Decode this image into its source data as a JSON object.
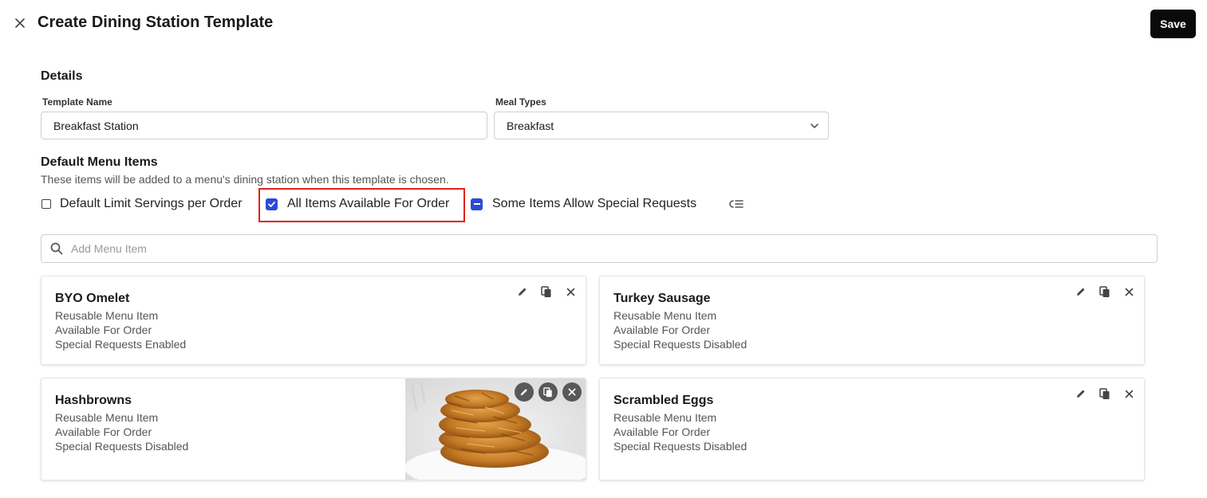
{
  "header": {
    "title": "Create Dining Station Template",
    "save_label": "Save"
  },
  "details": {
    "section_title": "Details",
    "template_name_label": "Template Name",
    "template_name_value": "Breakfast Station",
    "meal_types_label": "Meal Types",
    "meal_types_value": "Breakfast"
  },
  "menu": {
    "section_title": "Default Menu Items",
    "description": "These items will be added to a menu's dining station when this template is chosen.",
    "options": {
      "limit_servings": {
        "label": "Default Limit Servings per Order",
        "state": "unchecked"
      },
      "all_available": {
        "label": "All Items Available For Order",
        "state": "checked"
      },
      "special_requests": {
        "label": "Some Items Allow Special Requests",
        "state": "indeterminate"
      }
    },
    "search_placeholder": "Add Menu Item",
    "items": [
      {
        "name": "BYO Omelet",
        "line1": "Reusable Menu Item",
        "line2": "Available For Order",
        "line3": "Special Requests Enabled"
      },
      {
        "name": "Turkey Sausage",
        "line1": "Reusable Menu Item",
        "line2": "Available For Order",
        "line3": "Special Requests Disabled"
      },
      {
        "name": "Hashbrowns",
        "line1": "Reusable Menu Item",
        "line2": "Available For Order",
        "line3": "Special Requests Disabled",
        "image": "hashbrowns-photo"
      },
      {
        "name": "Scrambled Eggs",
        "line1": "Reusable Menu Item",
        "line2": "Available For Order",
        "line3": "Special Requests Disabled"
      }
    ]
  },
  "colors": {
    "accent": "#2b4ad6",
    "highlight": "#e0211b",
    "save_bg": "#0a0a0a"
  }
}
